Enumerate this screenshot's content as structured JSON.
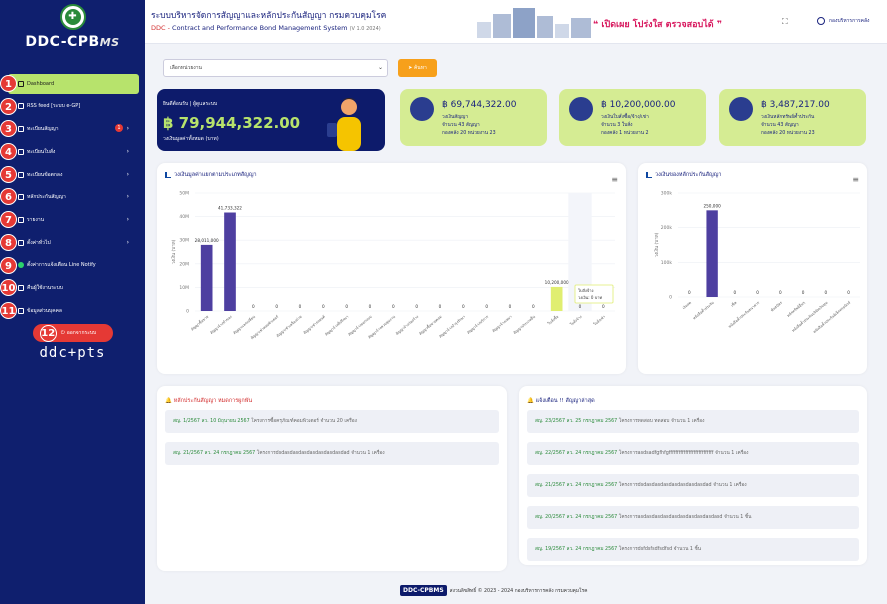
{
  "brand": {
    "name": "DDC-CPB",
    "suffix": "MS",
    "pts": "ddc+pts"
  },
  "menu": [
    {
      "n": "1",
      "label": "Dashboard",
      "icon": "home-icon",
      "arrow": false
    },
    {
      "n": "2",
      "label": "RSS feed [ระบบ e-GP]",
      "icon": "rss-icon",
      "arrow": false
    },
    {
      "n": "3",
      "label": "ทะเบียนสัญญา",
      "icon": "contract-icon",
      "arrow": true,
      "badge": "1"
    },
    {
      "n": "4",
      "label": "ทะเบียนใบสั่ง",
      "icon": "order-icon",
      "arrow": true
    },
    {
      "n": "5",
      "label": "ทะเบียนข้อตกลง",
      "icon": "agreement-icon",
      "arrow": true
    },
    {
      "n": "6",
      "label": "หลักประกันสัญญา",
      "icon": "money-icon",
      "arrow": true
    },
    {
      "n": "7",
      "label": "รายงาน",
      "icon": "report-icon",
      "arrow": true
    },
    {
      "n": "8",
      "label": "ตั้งค่าทั่วไป",
      "icon": "gear-icon",
      "arrow": true
    },
    {
      "n": "9",
      "label": "ตั้งค่าการแจ้งเตือน Line Notify",
      "icon": "line-icon",
      "arrow": false
    },
    {
      "n": "10",
      "label": "คืนผู้ใช้งานระบบ",
      "icon": "users-icon",
      "arrow": false
    },
    {
      "n": "11",
      "label": "ข้อมูลส่วนบุคคล",
      "icon": "user-icon",
      "arrow": false
    }
  ],
  "logout": {
    "n": "12",
    "label": "ออกจากระบบ"
  },
  "header": {
    "title": "ระบบบริหารจัดการสัญญาและหลักประกันสัญญา กรมควบคุมโรค",
    "subtitle_prefix": "DDC - ",
    "subtitle": "Contract and Performance Bond Management System",
    "version": "(V 1.0 2024)",
    "slogan": "❝ เปิดเผย โปร่งใส ตรวจสอบได้ ❞",
    "user": "กองบริหารการคลัง"
  },
  "filter": {
    "select_value": "เลือกหน่วยงาน",
    "button": "ค้นหา"
  },
  "total": {
    "label": "ยินดีต้อนรับ | ผู้ดูแลระบบ",
    "value": "฿ 79,944,322.00",
    "sub": "วงเงินมูลค่าทั้งหมด (บาท)"
  },
  "stats": [
    {
      "value": "฿ 69,744,322.00",
      "l1": "วงเงินสัญญา",
      "l2": "จำนวน 43 สัญญา",
      "l3": "กองคลัง 20 หน่วยงาน 23",
      "left": 400,
      "w": 147
    },
    {
      "value": "฿ 10,200,000.00",
      "l1": "วงเงินใบสั่งซื้อ/จ้าง/เช่า",
      "l2": "จำนวน 3 ใบสั่ง",
      "l3": "กองคลัง 1 หน่วยงาน 2",
      "left": 559,
      "w": 147
    },
    {
      "value": "฿ 3,487,217.00",
      "l1": "วงเงินหลักทรัพย์ค้ำประกัน",
      "l2": "จำนวน 43 สัญญา",
      "l3": "กองคลัง 20 หน่วยงาน 23",
      "left": 719,
      "w": 147
    }
  ],
  "chart1_title": "วงเงินมูลค่าแยกตามประเภทสัญญา",
  "chart2_title": "วงเงินของหลักประกันสัญญา",
  "chart_data": [
    {
      "type": "bar",
      "ylabel": "วงเงิน (บาท)",
      "ylim": [
        0,
        50000000
      ],
      "yticks": [
        "0",
        "10M",
        "20M",
        "30M",
        "40M",
        "50M"
      ],
      "categories": [
        "สัญญาซื้อขาย",
        "สัญญาจ้างทำของ",
        "สัญญาแลกเปลี่ยน",
        "สัญญาเช่าคอมพิวเตอร์",
        "สัญญาเช่าเครื่องถ่าย",
        "สัญญาเช่ารถยนต์",
        "สัญญาจ้างที่ปรึกษา",
        "สัญญาจ้างออกแบบ",
        "สัญญาจ้างควบคุมงาน",
        "สัญญาจ้างก่อสร้าง",
        "สัญญาซื้อขายคอม",
        "สัญญาจ้างบำรุงรักษา",
        "สัญญาจ้างบริการ",
        "สัญญาจ้างเหมา",
        "สัญญาประเภทอื่น",
        "ใบสั่งซื้อ",
        "ใบสั่งจ้าง",
        "ใบสั่งเช่า"
      ],
      "values": [
        28011000,
        41733322,
        0,
        0,
        0,
        0,
        0,
        0,
        0,
        0,
        0,
        0,
        0,
        0,
        0,
        10200000,
        0,
        0
      ],
      "labels": [
        "28,011,000",
        "41,733,322",
        "0",
        "0",
        "0",
        "0",
        "0",
        "0",
        "0",
        "0",
        "0",
        "0",
        "0",
        "0",
        "0",
        "10,200,000",
        "0",
        "0"
      ],
      "tooltip": {
        "title": "ใบสั่งจ้าง",
        "text": "วงเงิน: 0 บาท"
      }
    },
    {
      "type": "bar",
      "ylabel": "วงเงิน (บาท)",
      "ylim": [
        0,
        300000
      ],
      "yticks": [
        "0",
        "100k",
        "200k",
        "300k"
      ],
      "categories": [
        "เงินสด",
        "หนังสือค้ำประกัน",
        "เช็ค",
        "หนังสือค้ำประกันธนาคาร",
        "พันธบัตร",
        "หลักทรัพย์อื่นๆ",
        "หนังสือค้ำประกันบริษัทเงินทุน",
        "หนังสือค้ำประกันอิเล็กทรอนิกส์"
      ],
      "values": [
        0,
        250000,
        0,
        0,
        0,
        0,
        0,
        0
      ],
      "labels": [
        "0",
        "250,000",
        "0",
        "0",
        "0",
        "0",
        "0",
        "0"
      ]
    }
  ],
  "bond_panel": {
    "title": "หลักประกันสัญญา หมดการผูกพัน",
    "title_accent": "หมดการผูกพัน",
    "items": [
      {
        "ref": "สญ. 1/2567 ลว. 10 มิถุนายน 2567",
        "text": "โครงการซื้อครุภัณฑ์คอมพิวเตอร์ จำนวน 20 เครื่อง"
      },
      {
        "ref": "สญ. 21/2567 ลว. 24 กรกฎาคม 2567",
        "text": "โครงการdsdasdasdasdasdasdasdasdad จำนวน 1 เครื่อง"
      }
    ]
  },
  "alert_panel": {
    "title": "แจ้งเตือน !! สัญญาล่าสุด",
    "items": [
      {
        "ref": "สญ. 23/2567 ลว. 25 กรกฎาคม 2567",
        "text": "โครงการทดสอบ ทดสอบ จำนวน 1 เครื่อง"
      },
      {
        "ref": "สญ. 22/2567 ลว. 24 กรกฎาคม 2567",
        "text": "โครงการasdsadfgfhfgfffffffffffffffffffffffffff จำนวน 1 เครื่อง"
      },
      {
        "ref": "สญ. 21/2567 ลว. 24 กรกฎาคม 2567",
        "text": "โครงการdsdasdasdasdasdasdasdasdad จำนวน 1 เครื่อง"
      },
      {
        "ref": "สญ. 20/2567 ลว. 24 กรกฎาคม 2567",
        "text": "โครงการasdasdasdasdasdasdasdasdasdasd จำนวน 1 ชิ้น"
      },
      {
        "ref": "สญ. 19/2567 ลว. 24 กรกฎาคม 2567",
        "text": "โครงการdsfdsfsdfsdfsd จำนวน 1 ชิ้น"
      }
    ]
  },
  "footer": {
    "brand": "DDC-CPBMS",
    "text": "สงวนลิขสิทธิ์ © 2023 - 2024 กองบริหารการคลัง กรมควบคุมโรค"
  },
  "colors": {
    "sidebar": "#0f1f6e",
    "accent": "#b7e36c",
    "bar": "#4e3fa0",
    "badge": "#e53935",
    "stat": "#d5ec93"
  }
}
